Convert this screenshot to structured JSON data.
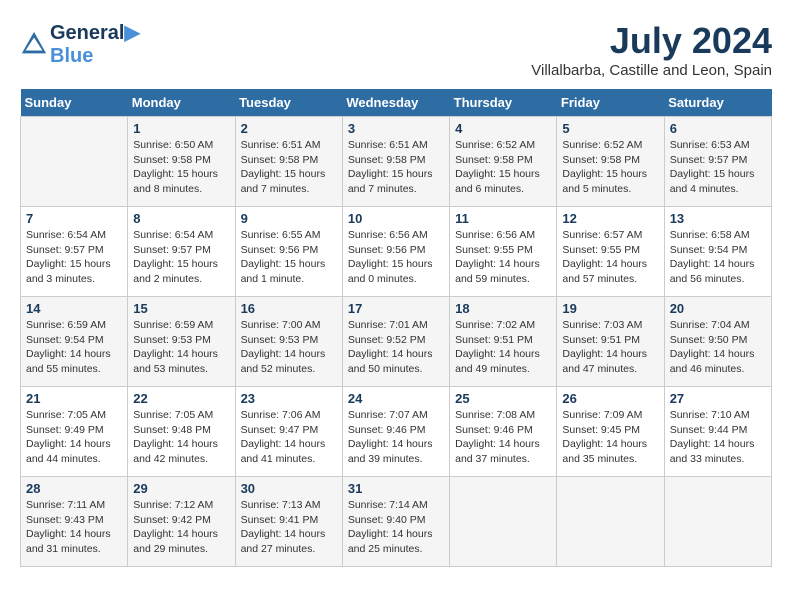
{
  "logo": {
    "line1": "General",
    "line2": "Blue"
  },
  "title": "July 2024",
  "subtitle": "Villalbarba, Castille and Leon, Spain",
  "days_of_week": [
    "Sunday",
    "Monday",
    "Tuesday",
    "Wednesday",
    "Thursday",
    "Friday",
    "Saturday"
  ],
  "weeks": [
    [
      {
        "day": "",
        "info": ""
      },
      {
        "day": "1",
        "info": "Sunrise: 6:50 AM\nSunset: 9:58 PM\nDaylight: 15 hours\nand 8 minutes."
      },
      {
        "day": "2",
        "info": "Sunrise: 6:51 AM\nSunset: 9:58 PM\nDaylight: 15 hours\nand 7 minutes."
      },
      {
        "day": "3",
        "info": "Sunrise: 6:51 AM\nSunset: 9:58 PM\nDaylight: 15 hours\nand 7 minutes."
      },
      {
        "day": "4",
        "info": "Sunrise: 6:52 AM\nSunset: 9:58 PM\nDaylight: 15 hours\nand 6 minutes."
      },
      {
        "day": "5",
        "info": "Sunrise: 6:52 AM\nSunset: 9:58 PM\nDaylight: 15 hours\nand 5 minutes."
      },
      {
        "day": "6",
        "info": "Sunrise: 6:53 AM\nSunset: 9:57 PM\nDaylight: 15 hours\nand 4 minutes."
      }
    ],
    [
      {
        "day": "7",
        "info": "Sunrise: 6:54 AM\nSunset: 9:57 PM\nDaylight: 15 hours\nand 3 minutes."
      },
      {
        "day": "8",
        "info": "Sunrise: 6:54 AM\nSunset: 9:57 PM\nDaylight: 15 hours\nand 2 minutes."
      },
      {
        "day": "9",
        "info": "Sunrise: 6:55 AM\nSunset: 9:56 PM\nDaylight: 15 hours\nand 1 minute."
      },
      {
        "day": "10",
        "info": "Sunrise: 6:56 AM\nSunset: 9:56 PM\nDaylight: 15 hours\nand 0 minutes."
      },
      {
        "day": "11",
        "info": "Sunrise: 6:56 AM\nSunset: 9:55 PM\nDaylight: 14 hours\nand 59 minutes."
      },
      {
        "day": "12",
        "info": "Sunrise: 6:57 AM\nSunset: 9:55 PM\nDaylight: 14 hours\nand 57 minutes."
      },
      {
        "day": "13",
        "info": "Sunrise: 6:58 AM\nSunset: 9:54 PM\nDaylight: 14 hours\nand 56 minutes."
      }
    ],
    [
      {
        "day": "14",
        "info": "Sunrise: 6:59 AM\nSunset: 9:54 PM\nDaylight: 14 hours\nand 55 minutes."
      },
      {
        "day": "15",
        "info": "Sunrise: 6:59 AM\nSunset: 9:53 PM\nDaylight: 14 hours\nand 53 minutes."
      },
      {
        "day": "16",
        "info": "Sunrise: 7:00 AM\nSunset: 9:53 PM\nDaylight: 14 hours\nand 52 minutes."
      },
      {
        "day": "17",
        "info": "Sunrise: 7:01 AM\nSunset: 9:52 PM\nDaylight: 14 hours\nand 50 minutes."
      },
      {
        "day": "18",
        "info": "Sunrise: 7:02 AM\nSunset: 9:51 PM\nDaylight: 14 hours\nand 49 minutes."
      },
      {
        "day": "19",
        "info": "Sunrise: 7:03 AM\nSunset: 9:51 PM\nDaylight: 14 hours\nand 47 minutes."
      },
      {
        "day": "20",
        "info": "Sunrise: 7:04 AM\nSunset: 9:50 PM\nDaylight: 14 hours\nand 46 minutes."
      }
    ],
    [
      {
        "day": "21",
        "info": "Sunrise: 7:05 AM\nSunset: 9:49 PM\nDaylight: 14 hours\nand 44 minutes."
      },
      {
        "day": "22",
        "info": "Sunrise: 7:05 AM\nSunset: 9:48 PM\nDaylight: 14 hours\nand 42 minutes."
      },
      {
        "day": "23",
        "info": "Sunrise: 7:06 AM\nSunset: 9:47 PM\nDaylight: 14 hours\nand 41 minutes."
      },
      {
        "day": "24",
        "info": "Sunrise: 7:07 AM\nSunset: 9:46 PM\nDaylight: 14 hours\nand 39 minutes."
      },
      {
        "day": "25",
        "info": "Sunrise: 7:08 AM\nSunset: 9:46 PM\nDaylight: 14 hours\nand 37 minutes."
      },
      {
        "day": "26",
        "info": "Sunrise: 7:09 AM\nSunset: 9:45 PM\nDaylight: 14 hours\nand 35 minutes."
      },
      {
        "day": "27",
        "info": "Sunrise: 7:10 AM\nSunset: 9:44 PM\nDaylight: 14 hours\nand 33 minutes."
      }
    ],
    [
      {
        "day": "28",
        "info": "Sunrise: 7:11 AM\nSunset: 9:43 PM\nDaylight: 14 hours\nand 31 minutes."
      },
      {
        "day": "29",
        "info": "Sunrise: 7:12 AM\nSunset: 9:42 PM\nDaylight: 14 hours\nand 29 minutes."
      },
      {
        "day": "30",
        "info": "Sunrise: 7:13 AM\nSunset: 9:41 PM\nDaylight: 14 hours\nand 27 minutes."
      },
      {
        "day": "31",
        "info": "Sunrise: 7:14 AM\nSunset: 9:40 PM\nDaylight: 14 hours\nand 25 minutes."
      },
      {
        "day": "",
        "info": ""
      },
      {
        "day": "",
        "info": ""
      },
      {
        "day": "",
        "info": ""
      }
    ]
  ]
}
